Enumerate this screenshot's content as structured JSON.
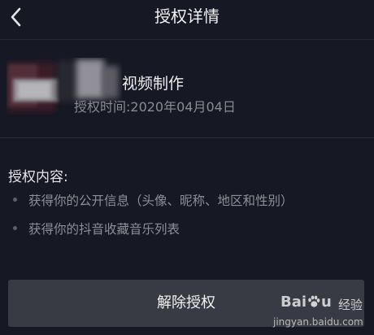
{
  "header": {
    "title": "授权详情",
    "back_icon": "chevron-left-icon"
  },
  "app": {
    "name_visible": "视频制作",
    "auth_time": "授权时间:2020年04月04日"
  },
  "content": {
    "heading": "授权内容:",
    "items": [
      "获得你的公开信息（头像、昵称、地区和性别）",
      "获得你的抖音收藏音乐列表"
    ]
  },
  "actions": {
    "revoke_label": "解除授权"
  },
  "watermark": {
    "brand_left": "Bai",
    "brand_right": "u",
    "sub": "经验",
    "url": "jingyan.baidu.com"
  },
  "colors": {
    "background": "#161823",
    "button": "#393b44",
    "secondary_text": "#8a8b93"
  }
}
